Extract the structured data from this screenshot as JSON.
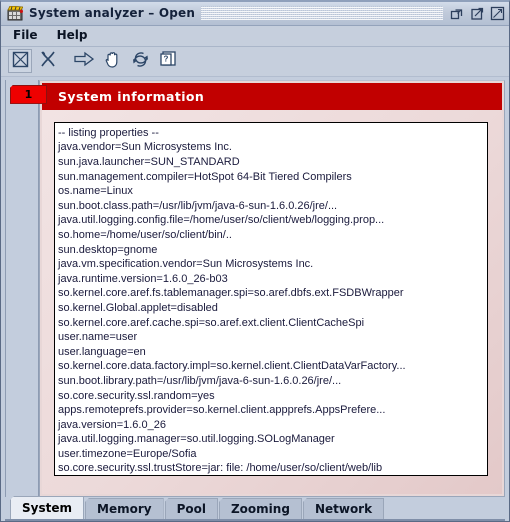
{
  "window": {
    "title": "System analyzer – Open",
    "app_icon": "clapperboard-icon",
    "buttons": [
      {
        "name": "restore-button",
        "icon": "restore-icon"
      },
      {
        "name": "maximize-button",
        "icon": "maximize-icon"
      },
      {
        "name": "close-button",
        "icon": "close-icon"
      }
    ]
  },
  "menubar": {
    "items": [
      {
        "label": "File",
        "name": "menu-file"
      },
      {
        "label": "Help",
        "name": "menu-help"
      }
    ]
  },
  "toolbar": {
    "buttons": [
      {
        "name": "stop-button",
        "icon": "x-box-icon",
        "selected": true
      },
      {
        "name": "cut-button",
        "icon": "scissors-icon",
        "selected": false
      },
      {
        "name": "forward-button",
        "icon": "arrow-right-icon",
        "selected": false
      },
      {
        "name": "hand-button",
        "icon": "hand-icon",
        "selected": false
      },
      {
        "name": "refresh-button",
        "icon": "refresh-icon",
        "selected": false
      },
      {
        "name": "help-button",
        "icon": "help-document-icon",
        "selected": false
      }
    ]
  },
  "side_tab": {
    "label": "1",
    "color": "#ee0000"
  },
  "panel": {
    "banner_title": "System information",
    "banner_color": "#c10000",
    "lines": [
      "-- listing properties --",
      "java.vendor=Sun Microsystems Inc.",
      "sun.java.launcher=SUN_STANDARD",
      "sun.management.compiler=HotSpot 64-Bit Tiered Compilers",
      "os.name=Linux",
      "sun.boot.class.path=/usr/lib/jvm/java-6-sun-1.6.0.26/jre/...",
      "java.util.logging.config.file=/home/user/so/client/web/logging.prop...",
      "so.home=/home/user/so/client/bin/..",
      "sun.desktop=gnome",
      "java.vm.specification.vendor=Sun Microsystems Inc.",
      "java.runtime.version=1.6.0_26-b03",
      "so.kernel.core.aref.fs.tablemanager.spi=so.aref.dbfs.ext.FSDBWrapper",
      "so.kernel.Global.applet=disabled",
      "so.kernel.core.aref.cache.spi=so.aref.ext.client.ClientCacheSpi",
      "user.name=user",
      "user.language=en",
      "so.kernel.core.data.factory.impl=so.kernel.client.ClientDataVarFactory...",
      "sun.boot.library.path=/usr/lib/jvm/java-6-sun-1.6.0.26/jre/...",
      "so.core.security.ssl.random=yes",
      "apps.remoteprefs.provider=so.kernel.client.appprefs.AppsPrefere...",
      "java.version=1.6.0_26",
      "java.util.logging.manager=so.util.logging.SOLogManager",
      "user.timezone=Europe/Sofia",
      "so.core.security.ssl.trustStore=jar: file: /home/user/so/client/web/lib"
    ]
  },
  "tabs": {
    "items": [
      {
        "label": "System",
        "name": "tab-system",
        "active": true
      },
      {
        "label": "Memory",
        "name": "tab-memory",
        "active": false
      },
      {
        "label": "Pool",
        "name": "tab-pool",
        "active": false
      },
      {
        "label": "Zooming",
        "name": "tab-zooming",
        "active": false
      },
      {
        "label": "Network",
        "name": "tab-network",
        "active": false
      }
    ]
  }
}
